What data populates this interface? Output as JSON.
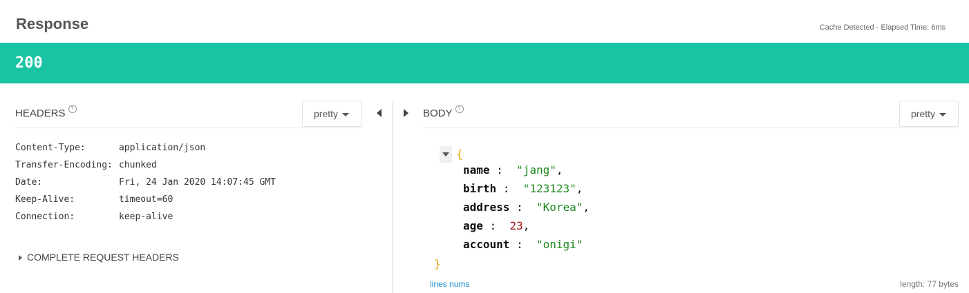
{
  "response": {
    "title": "Response",
    "cache_text": "Cache Detected - Elapsed Time: 6ms",
    "status_code": "200",
    "status_color": "#18c4a4"
  },
  "headers_panel": {
    "title": "HEADERS",
    "help_icon": "?",
    "format_label": "pretty",
    "rows": [
      {
        "key": "Content-Type:",
        "value": "application/json"
      },
      {
        "key": "Transfer-Encoding:",
        "value": "chunked"
      },
      {
        "key": "Date:",
        "value": "Fri, 24 Jan 2020 14:07:45 GMT"
      },
      {
        "key": "Keep-Alive:",
        "value": "timeout=60"
      },
      {
        "key": "Connection:",
        "value": "keep-alive"
      }
    ],
    "complete_label": "COMPLETE REQUEST HEADERS"
  },
  "body_panel": {
    "title": "BODY",
    "help_icon": "?",
    "format_label": "pretty",
    "json_open": "{",
    "json_close": "}",
    "fields": [
      {
        "key": "name",
        "value": "\"jang\"",
        "type": "string",
        "comma": ","
      },
      {
        "key": "birth",
        "value": "\"123123\"",
        "type": "string",
        "comma": ","
      },
      {
        "key": "address",
        "value": "\"Korea\"",
        "type": "string",
        "comma": ","
      },
      {
        "key": "age",
        "value": "23",
        "type": "number",
        "comma": ","
      },
      {
        "key": "account",
        "value": "\"onigi\"",
        "type": "string",
        "comma": ""
      }
    ],
    "lines_nums_label": "lines nums",
    "length_label": "length: 77 bytes"
  }
}
